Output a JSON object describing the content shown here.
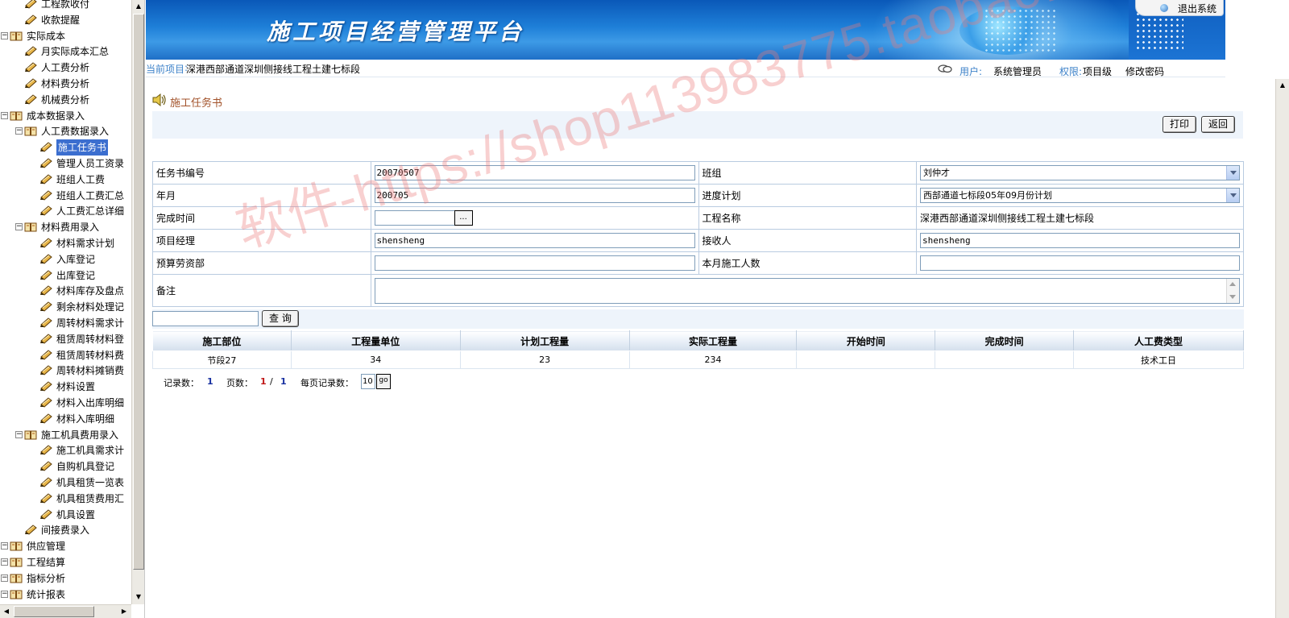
{
  "app": {
    "title": "施工项目经营管理平台",
    "logout": "退出系统"
  },
  "infobar": {
    "current_project_label": "当前项目",
    "current_project": "深港西部通道深圳侧接线工程土建七标段",
    "user_label": "用户:",
    "user": "系统管理员",
    "permission_label": "权限:",
    "permission": "项目级",
    "change_password": "修改密码"
  },
  "tree": [
    {
      "label": "工程款收付",
      "level": 2,
      "kind": "leaf"
    },
    {
      "label": "收款提醒",
      "level": 2,
      "kind": "leaf"
    },
    {
      "label": "实际成本",
      "level": 1,
      "kind": "folder"
    },
    {
      "label": "月实际成本汇总",
      "level": 2,
      "kind": "leaf"
    },
    {
      "label": "人工费分析",
      "level": 2,
      "kind": "leaf"
    },
    {
      "label": "材料费分析",
      "level": 2,
      "kind": "leaf"
    },
    {
      "label": "机械费分析",
      "level": 2,
      "kind": "leaf"
    },
    {
      "label": "成本数据录入",
      "level": 1,
      "kind": "folder"
    },
    {
      "label": "人工费数据录入",
      "level": 2,
      "kind": "folder"
    },
    {
      "label": "施工任务书",
      "level": 3,
      "kind": "leaf",
      "selected": true
    },
    {
      "label": "管理人员工资录",
      "level": 3,
      "kind": "leaf"
    },
    {
      "label": "班组人工费",
      "level": 3,
      "kind": "leaf"
    },
    {
      "label": "班组人工费汇总",
      "level": 3,
      "kind": "leaf"
    },
    {
      "label": "人工费汇总详细",
      "level": 3,
      "kind": "leaf"
    },
    {
      "label": "材料费用录入",
      "level": 2,
      "kind": "folder"
    },
    {
      "label": "材料需求计划",
      "level": 3,
      "kind": "leaf"
    },
    {
      "label": "入库登记",
      "level": 3,
      "kind": "leaf"
    },
    {
      "label": "出库登记",
      "level": 3,
      "kind": "leaf"
    },
    {
      "label": "材料库存及盘点",
      "level": 3,
      "kind": "leaf"
    },
    {
      "label": "剩余材料处理记",
      "level": 3,
      "kind": "leaf"
    },
    {
      "label": "周转材料需求计",
      "level": 3,
      "kind": "leaf"
    },
    {
      "label": "租赁周转材料登",
      "level": 3,
      "kind": "leaf"
    },
    {
      "label": "租赁周转材料费",
      "level": 3,
      "kind": "leaf"
    },
    {
      "label": "周转材料摊销费",
      "level": 3,
      "kind": "leaf"
    },
    {
      "label": "材料设置",
      "level": 3,
      "kind": "leaf"
    },
    {
      "label": "材料入出库明细",
      "level": 3,
      "kind": "leaf"
    },
    {
      "label": "材料入库明细",
      "level": 3,
      "kind": "leaf"
    },
    {
      "label": "施工机具费用录入",
      "level": 2,
      "kind": "folder"
    },
    {
      "label": "施工机具需求计",
      "level": 3,
      "kind": "leaf"
    },
    {
      "label": "自购机具登记",
      "level": 3,
      "kind": "leaf"
    },
    {
      "label": "机具租赁一览表",
      "level": 3,
      "kind": "leaf"
    },
    {
      "label": "机具租赁费用汇",
      "level": 3,
      "kind": "leaf"
    },
    {
      "label": "机具设置",
      "level": 3,
      "kind": "leaf"
    },
    {
      "label": "间接费录入",
      "level": 2,
      "kind": "leaf"
    },
    {
      "label": "供应管理",
      "level": 1,
      "kind": "folder"
    },
    {
      "label": "工程结算",
      "level": 1,
      "kind": "folder"
    },
    {
      "label": "指标分析",
      "level": 1,
      "kind": "folder"
    },
    {
      "label": "统计报表",
      "level": 1,
      "kind": "folder"
    }
  ],
  "page": {
    "title": "施工任务书",
    "print_button": "打印",
    "back_button": "返回"
  },
  "form": {
    "task_no_label": "任务书编号",
    "task_no": "20070507",
    "team_label": "班组",
    "team": "刘仲才",
    "year_month_label": "年月",
    "year_month": "200705",
    "schedule_label": "进度计划",
    "schedule": "西部通道七标段05年09月份计划",
    "finish_time_label": "完成时间",
    "finish_time": "",
    "date_button": "...",
    "project_name_label": "工程名称",
    "project_name": "深港西部通道深圳侧接线工程土建七标段",
    "manager_label": "项目经理",
    "manager": "shensheng",
    "receiver_label": "接收人",
    "receiver": "shensheng",
    "budget_label": "预算劳资部",
    "budget": "",
    "workers_label": "本月施工人数",
    "workers": "",
    "remark_label": "备注",
    "remark": ""
  },
  "query": {
    "value": "",
    "button": "查 询"
  },
  "grid": {
    "columns": [
      "施工部位",
      "工程量单位",
      "计划工程量",
      "实际工程量",
      "开始时间",
      "完成时间",
      "人工费类型"
    ],
    "rows": [
      [
        "节段27",
        "34",
        "23",
        "234",
        "",
        "",
        "技术工日"
      ]
    ]
  },
  "pager": {
    "records_label": "记录数：",
    "records": "1",
    "pages_label": "页数：",
    "page_current": "1",
    "page_sep": "/",
    "page_total": "1",
    "per_page_label": "每页记录数：",
    "per_page": "10",
    "go": "go"
  },
  "watermark": "软件-https://shop113983775.taobao.com",
  "colors": {
    "banner": "#1e7fd8",
    "label_blue": "#3d82c9",
    "title_brown": "#a2522a",
    "selected": "#3b6ecf"
  }
}
